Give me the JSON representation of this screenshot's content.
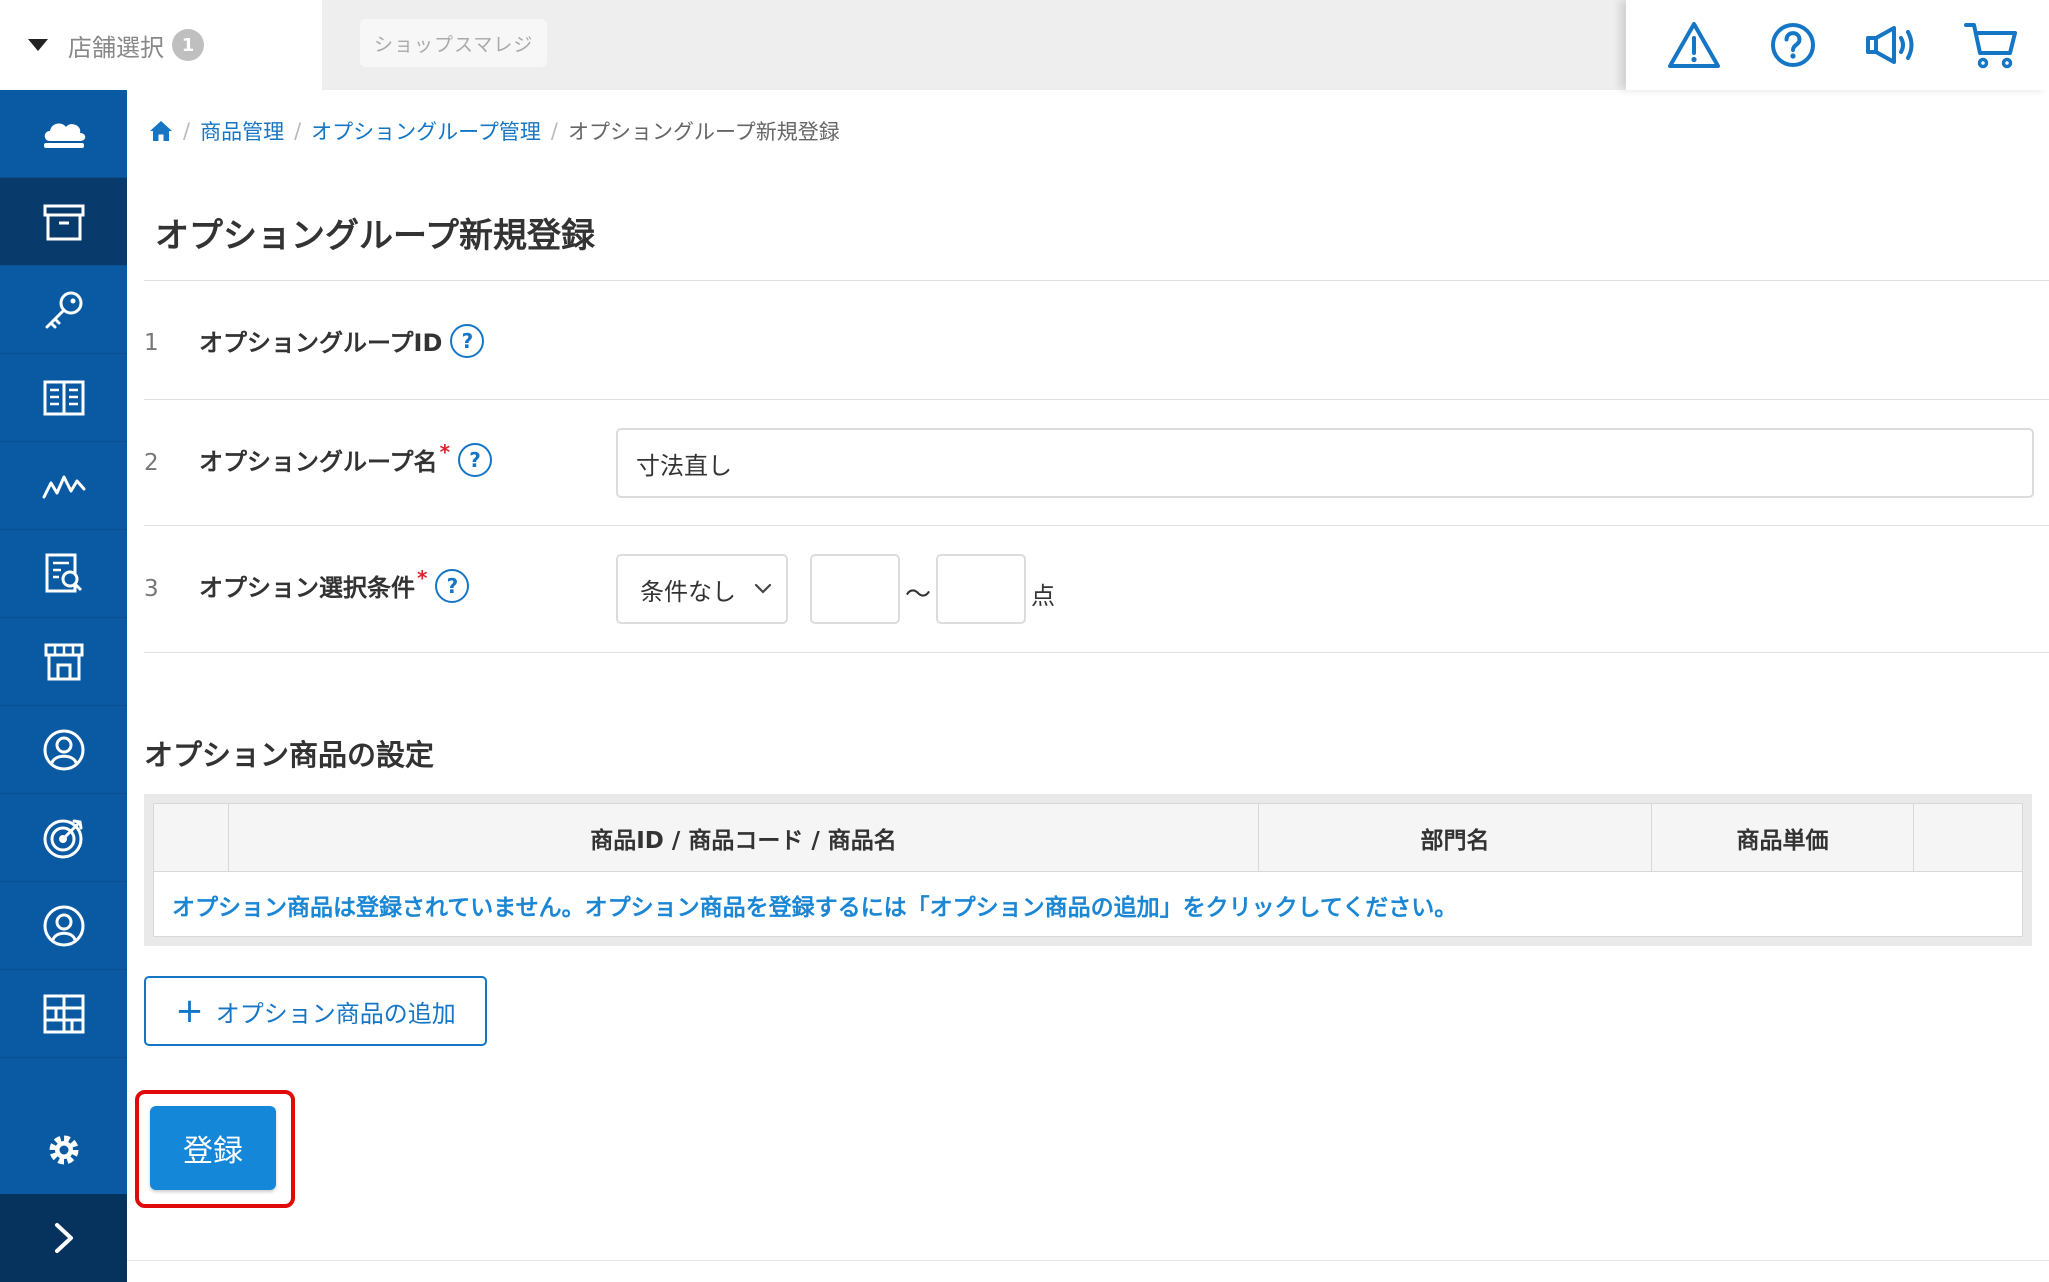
{
  "header": {
    "store_select_label": "店舗選択",
    "store_count": "1",
    "shop_name": "ショップスマレジ",
    "icons": [
      "warning-icon",
      "help-icon",
      "megaphone-icon",
      "cart-icon"
    ]
  },
  "sidebar": {
    "items": [
      "cloud-icon",
      "product-box-icon",
      "key-icon",
      "book-icon",
      "chart-line-icon",
      "report-icon",
      "store-icon",
      "customer-icon",
      "target-icon",
      "staff-icon",
      "apps-grid-icon"
    ],
    "active_index": 1,
    "bottom": [
      "settings-gear-icon",
      "expand-chevron-icon"
    ]
  },
  "breadcrumb": {
    "home_icon": "home-icon",
    "items": [
      "商品管理",
      "オプショングループ管理"
    ],
    "current": "オプショングループ新規登録"
  },
  "page_title": "オプショングループ新規登録",
  "form": {
    "rows": [
      {
        "num": "1",
        "label": "オプショングループID",
        "required": false
      },
      {
        "num": "2",
        "label": "オプショングループ名",
        "required": true
      },
      {
        "num": "3",
        "label": "オプション選択条件",
        "required": true
      }
    ],
    "required_mark": "*",
    "help_mark": "?",
    "group_name_value": "寸法直し",
    "condition_select_value": "条件なし",
    "range_min": "",
    "range_max": "",
    "range_separator": "〜",
    "range_unit": "点"
  },
  "option_products": {
    "section_title": "オプション商品の設定",
    "columns": [
      "",
      "商品ID / 商品コード / 商品名",
      "部門名",
      "商品単価",
      ""
    ],
    "empty_message": "オプション商品は登録されていません。オプション商品を登録するには「オプション商品の追加」をクリックしてください。",
    "add_button_label": "オプション商品の追加"
  },
  "submit_label": "登録",
  "colors": {
    "sidebar": "#0a5aa3",
    "accent": "#1576c5",
    "submit": "#1487d9",
    "highlight": "#e10a0a"
  }
}
